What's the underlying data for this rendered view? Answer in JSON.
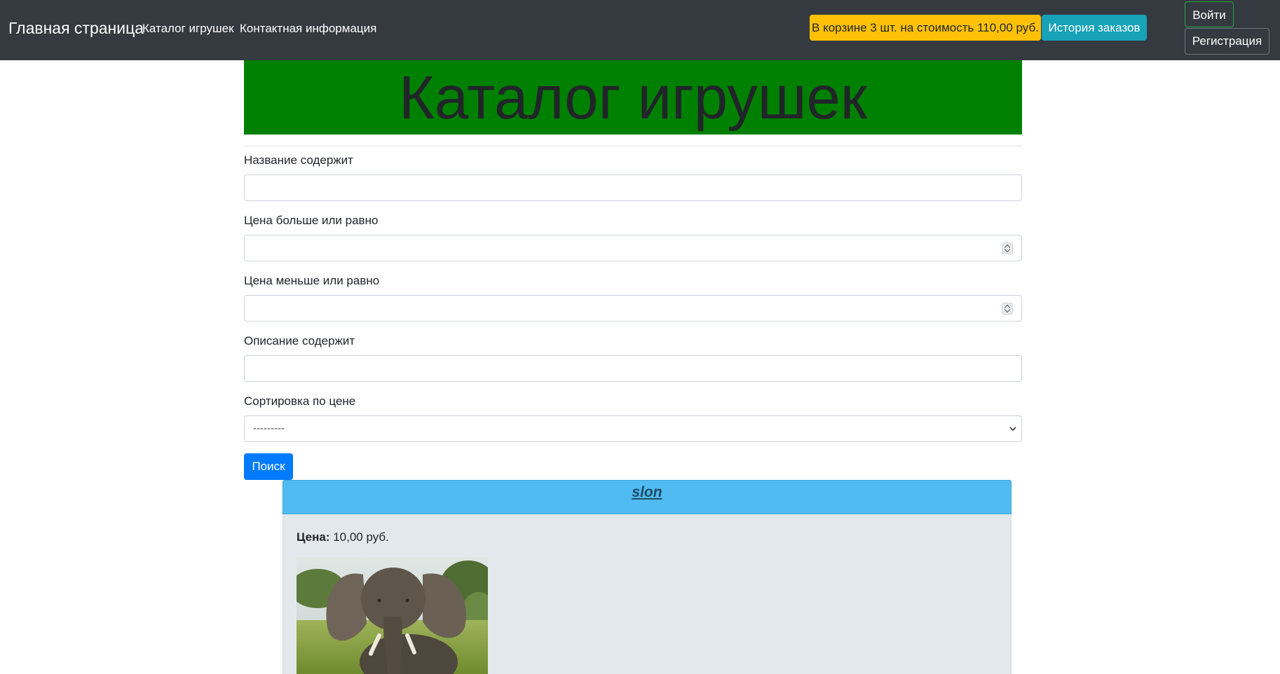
{
  "navbar": {
    "brand": "Главная страница",
    "links": [
      "Каталог игрушек",
      "Контактная информация"
    ],
    "cart_status": "В корзине 3 шт. на стоимость 110,00 руб.",
    "history_button": "История заказов",
    "login_button": "Войти",
    "register_button": "Регистрация"
  },
  "banner": {
    "title": "Каталог игрушек"
  },
  "form": {
    "name_label": "Название содержит",
    "price_min_label": "Цена больше или равно",
    "price_max_label": "Цена меньше или равно",
    "description_label": "Описание содержит",
    "sort_label": "Сортировка по цене",
    "sort_value": "---------",
    "search_button": "Поиск"
  },
  "product": {
    "title": "slon",
    "price_label": "Цена:",
    "price_value": " 10,00 руб.",
    "image_subject": "elephant-photo"
  },
  "colors": {
    "navbar": "#343a40",
    "banner": "#008000",
    "cart_badge": "#ffc107",
    "history_button": "#17a2b8",
    "search_button": "#007bff",
    "card_header": "#4fbbf0",
    "card_body": "#e3e8ec"
  }
}
